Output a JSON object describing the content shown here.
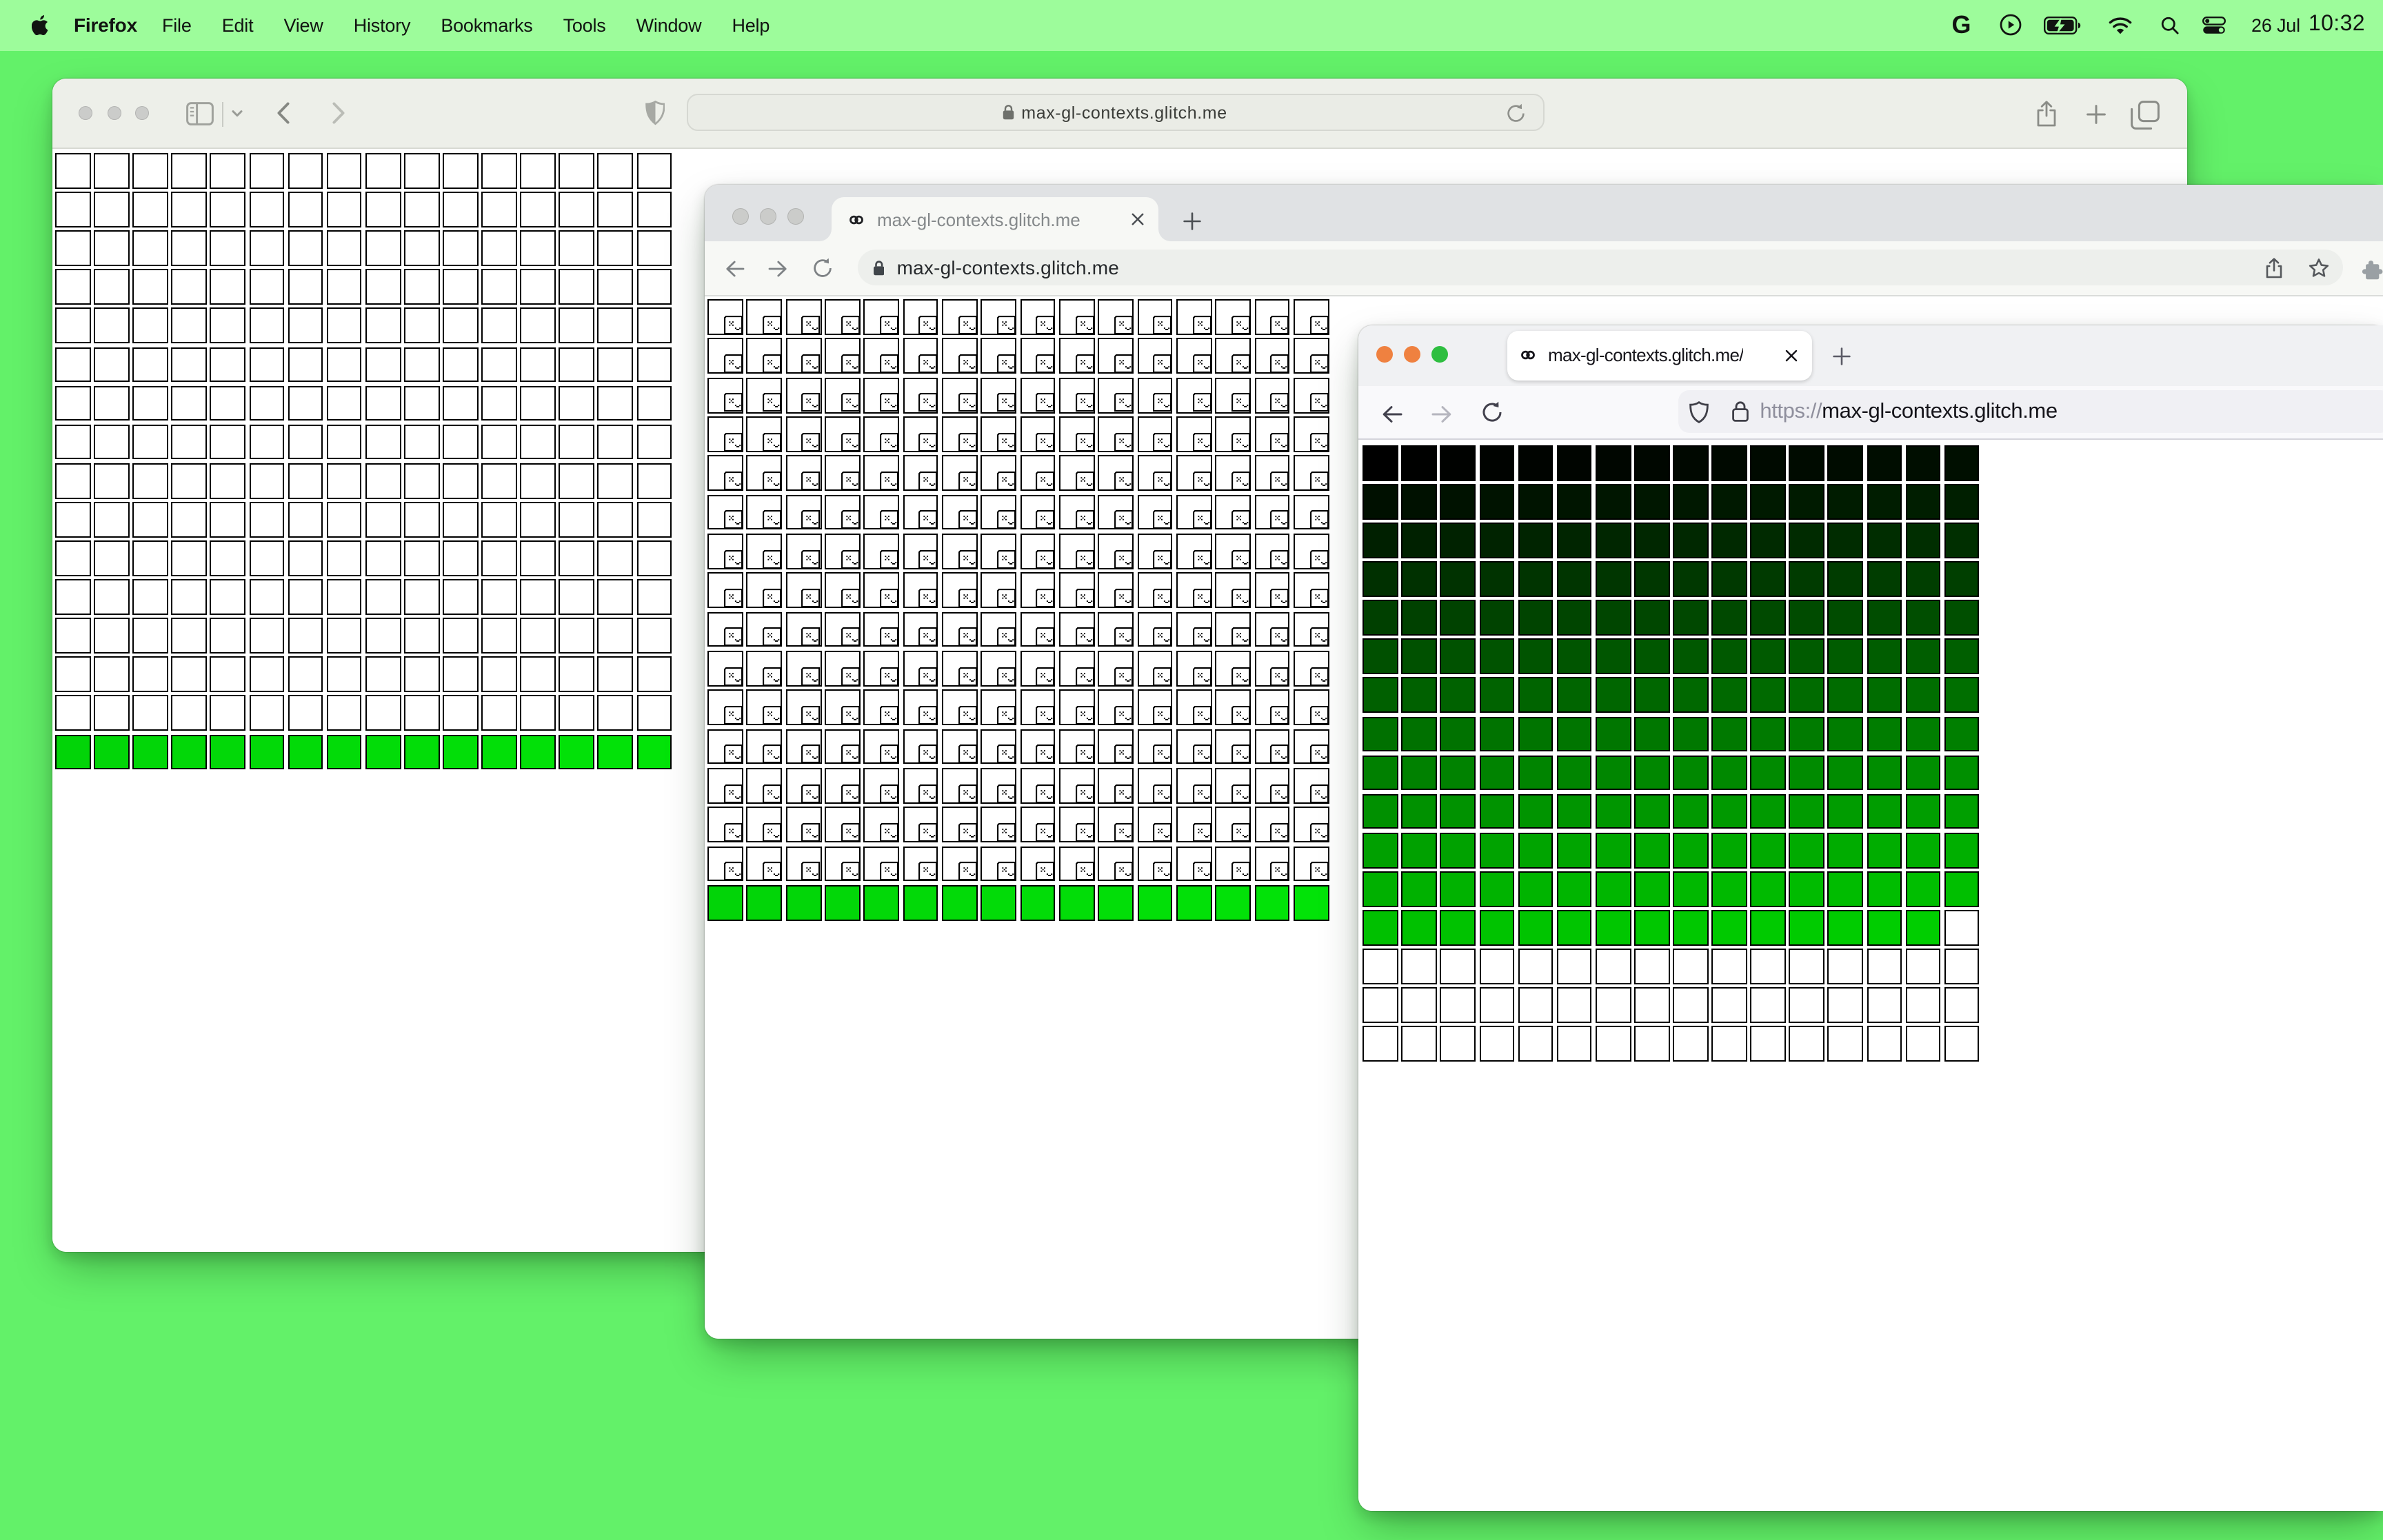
{
  "menu_bar": {
    "apple_icon": "apple-logo",
    "items": [
      "Firefox",
      "File",
      "Edit",
      "View",
      "History",
      "Bookmarks",
      "Tools",
      "Window",
      "Help"
    ],
    "status_icons": [
      "g-logo",
      "play-circle",
      "battery-charging",
      "wifi",
      "search",
      "control-center"
    ],
    "g_label": "G",
    "date": "26 Jul",
    "time": "10:32"
  },
  "desktop": {
    "background": "#63f169",
    "menubar_background": "#9dfc9b"
  },
  "safari": {
    "url": "max-gl-contexts.glitch.me",
    "toolbar_icons": [
      "sidebar",
      "chevron-down",
      "back",
      "forward",
      "shield",
      "lock",
      "reload",
      "share",
      "new-tab",
      "tabs-overview"
    ],
    "traffic_lights": [
      "#cbccca",
      "#cbccca",
      "#cbccca"
    ],
    "grid": {
      "cols": 16,
      "rows": 16,
      "blank_rows": 15,
      "green_row_start_index": 240
    }
  },
  "chrome": {
    "tab_title": "max-gl-contexts.glitch.me",
    "url": "max-gl-contexts.glitch.me",
    "toolbar_icons": [
      "back",
      "forward",
      "reload",
      "lock",
      "share",
      "star",
      "extensions"
    ],
    "traffic_lights": [
      "#d2d4d1",
      "#d2d4d1",
      "#d2d4d1"
    ],
    "grid": {
      "cols": 16,
      "rows": 16,
      "broken_rows": 15,
      "green_row_start_index": 240
    }
  },
  "firefox": {
    "tab_title": "max-gl-contexts.glitch.me/",
    "url_scheme": "https://",
    "url_domain": "max-gl-contexts.glitch.me",
    "toolbar_icons": [
      "back",
      "forward",
      "reload",
      "shield",
      "lock"
    ],
    "traffic_lights": [
      "#ef8140",
      "#ef8140",
      "#2ebe40"
    ],
    "grid": {
      "cols": 16,
      "rows": 16,
      "colored_cells": 207,
      "color_formula": "rgb(0,index,0)"
    }
  },
  "green_cell_base": [
    2,
    212,
    8
  ]
}
